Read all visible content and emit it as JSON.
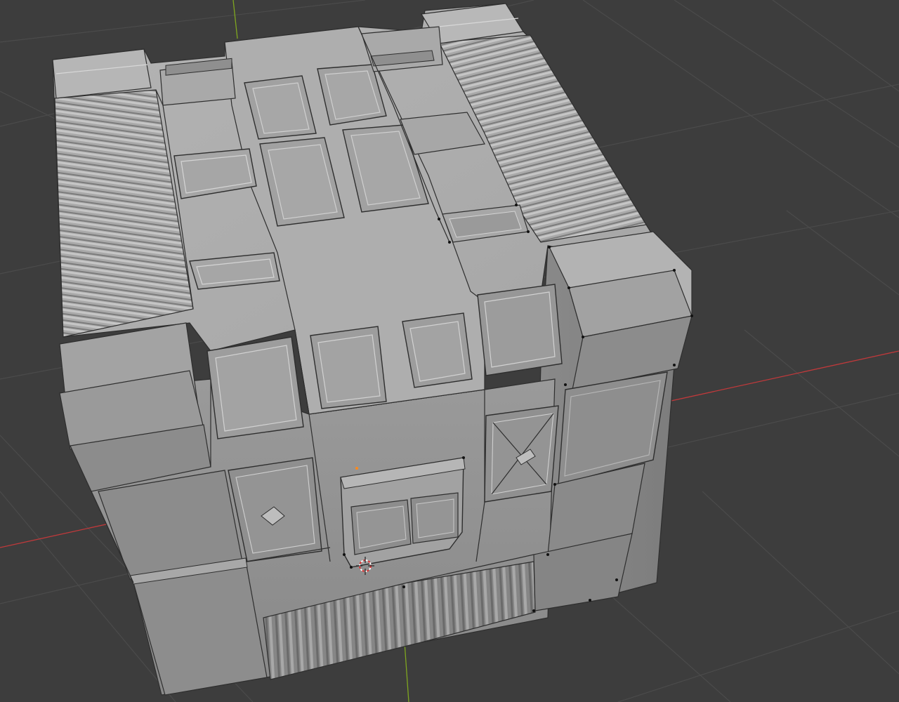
{
  "viewport": {
    "background": "#3d3d3d",
    "grid_color": "#4b4b4b",
    "x_axis_color": "#c0393b",
    "y_axis_color": "#7fa61f"
  },
  "model": {
    "base_color": "#9e9e9e",
    "light_color": "#b3b3b3",
    "dark_color": "#7f7f7f",
    "shadow_color": "#6e6e6e",
    "vertex_color": "#111111",
    "origin_color": "#ff8a1a"
  },
  "icons": {
    "cursor": "3d-cursor-icon",
    "origin": "object-origin-icon"
  }
}
